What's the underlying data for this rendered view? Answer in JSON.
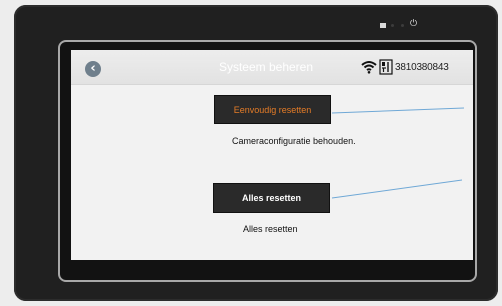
{
  "header": {
    "title": "Systeem beheren",
    "serial": "3810380843"
  },
  "actions": {
    "simple_reset": {
      "label": "Eenvoudig resetten",
      "caption": "Cameraconfiguratie behouden."
    },
    "full_reset": {
      "label": "Alles resetten",
      "caption": "Alles resetten"
    }
  },
  "icons": {
    "back": "back-arrow-icon",
    "wifi": "wifi-icon",
    "device": "device-icon",
    "power": "power-icon"
  },
  "colors": {
    "header_title": "#ffffff",
    "simple_reset_text": "#e57c27",
    "button_bg": "#2a2a2a",
    "annotation_line": "#6fa8d6"
  }
}
